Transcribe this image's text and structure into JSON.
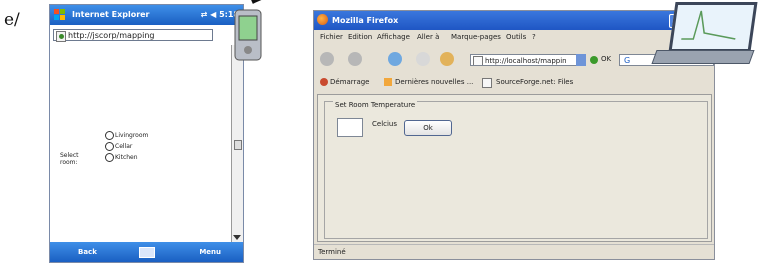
{
  "figure_label": "e/",
  "pocket_pc": {
    "title": "Internet Explorer",
    "status": "⇄ ◀ 5:18",
    "address": "http://jscorp/mapping",
    "form": {
      "select_label": "Select room:",
      "options": [
        "Livingroom",
        "Cellar",
        "Kitchen"
      ]
    },
    "bottom": {
      "back": "Back",
      "menu": "Menu"
    }
  },
  "firefox": {
    "title": "Mozilla Firefox",
    "menu": [
      "Fichier",
      "Edition",
      "Affichage",
      "Aller à",
      "Marque-pages",
      "Outils",
      "?"
    ],
    "address": "http://localhost/mappin",
    "ok": "OK",
    "search": "G",
    "bookmarks": [
      "Démarrage",
      "Dernières nouvelles ...",
      "SourceForge.net: Files"
    ],
    "fieldset_legend": "Set Room Temperature",
    "unit_label": "Celcius",
    "ok_button": "Ok",
    "status": "Terminé"
  },
  "colors": {
    "xp_blue": "#1f56c4",
    "window_bg": "#e5e0d4",
    "content_bg": "#ebe8dd"
  }
}
